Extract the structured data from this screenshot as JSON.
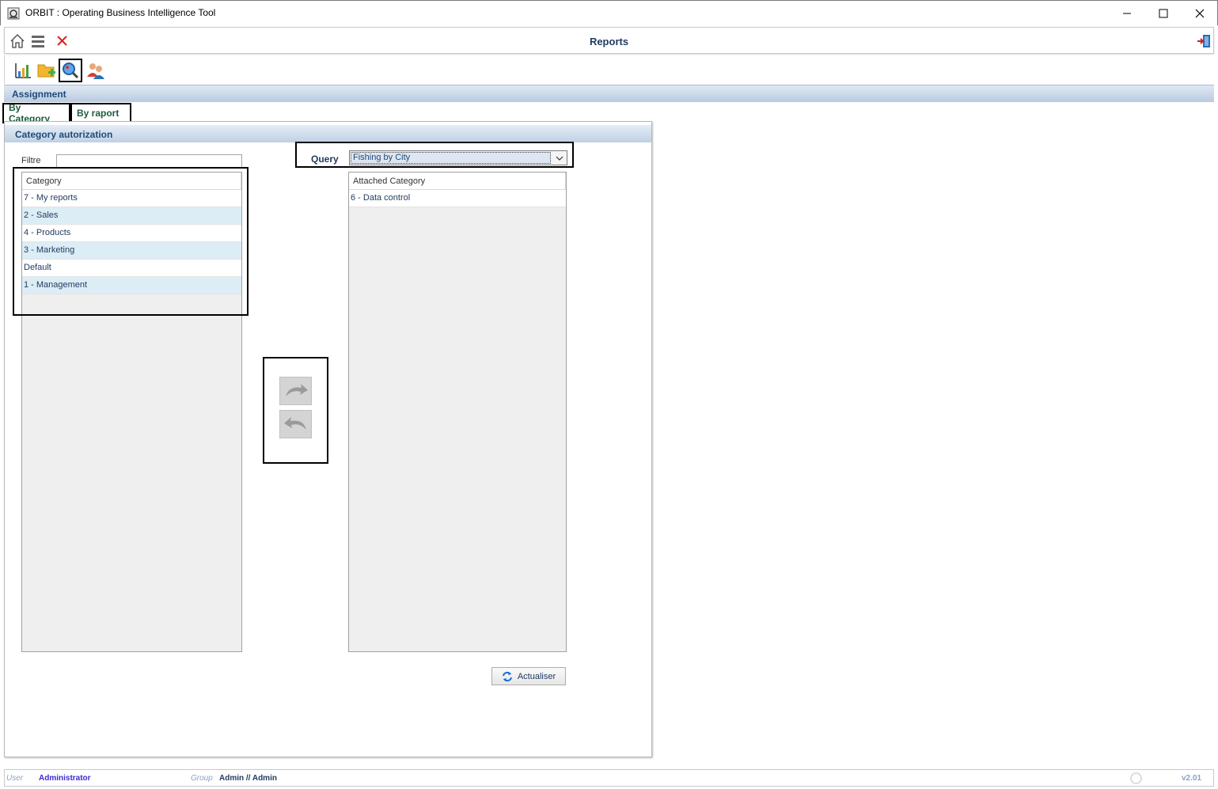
{
  "window": {
    "title": "ORBIT : Operating Business Intelligence Tool"
  },
  "header": {
    "title": "Reports"
  },
  "assignment": {
    "label": "Assignment"
  },
  "tabs": [
    {
      "label": "By Category"
    },
    {
      "label": "By raport"
    }
  ],
  "panel": {
    "title": "Category autorization",
    "filter_label": "Filtre",
    "filter_value": "",
    "query_label": "Query",
    "query_selected": "Fishing by City",
    "left_list": {
      "header": "Category",
      "items": [
        "7 - My reports",
        "2 - Sales",
        "4 - Products",
        "3 - Marketing",
        "Default",
        "1 - Management"
      ]
    },
    "right_list": {
      "header": "Attached Category",
      "items": [
        "6 - Data control"
      ]
    },
    "refresh_label": "Actualiser"
  },
  "status": {
    "user_label": "User",
    "user_value": "Administrator",
    "group_label": "Group",
    "group_value": "Admin // Admin",
    "version": "v2.01"
  }
}
